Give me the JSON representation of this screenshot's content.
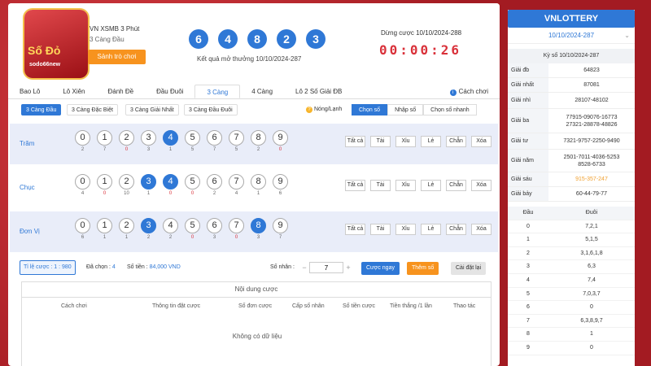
{
  "header": {
    "game_title": "VN XSMB 3 Phút",
    "game_sub": "3 Càng Đầu",
    "sponsor_btn": "Sảnh trò chơi",
    "logo_text": "Số Đỏ",
    "logo_sub": "sodo66new",
    "balls": [
      "6",
      "4",
      "8",
      "2",
      "3"
    ],
    "result_label": "Kết quả mở thưởng 10/10/2024-287",
    "deadline_label": "Dừng cược 10/10/2024-288",
    "countdown": "00:00:26"
  },
  "tabs": [
    "Bao Lô",
    "Lô Xiên",
    "Đánh Đề",
    "Đầu Đuôi",
    "3 Càng",
    "4 Càng",
    "Lô 2 Số Giải ĐB"
  ],
  "active_tab": 4,
  "howto": "Cách chơi",
  "subtabs": [
    "3 Càng Đầu",
    "3 Càng Đặc Biệt",
    "3 Càng Giải Nhất",
    "3 Càng Đầu Đuôi"
  ],
  "hot_cold": "Nóng/Lạnh",
  "modes": [
    "Chọn số",
    "Nhập số",
    "Chọn số nhanh"
  ],
  "positions": [
    {
      "label": "Trăm",
      "selected": [
        4
      ],
      "miss": [
        "2",
        "7",
        "0",
        "3",
        "1",
        "5",
        "7",
        "5",
        "2",
        "0"
      ]
    },
    {
      "label": "Chục",
      "selected": [
        3,
        4
      ],
      "miss": [
        "4",
        "0",
        "10",
        "1",
        "0",
        "0",
        "2",
        "4",
        "1",
        "6"
      ]
    },
    {
      "label": "Đơn Vị",
      "selected": [
        3,
        8
      ],
      "miss": [
        "6",
        "1",
        "1",
        "2",
        "2",
        "0",
        "3",
        "0",
        "3",
        "7"
      ]
    }
  ],
  "filters": [
    "Tất cả",
    "Tài",
    "Xỉu",
    "Lẻ",
    "Chẵn",
    "Xóa"
  ],
  "bottom": {
    "rate_label": "Tỉ lệ cược : ",
    "rate_value": "1 : 980",
    "chosen_label": "Đã chọn : ",
    "chosen_value": "4",
    "amount_label": "Số tiền : ",
    "amount_value": "84,000 VND",
    "mult_label": "Số nhân :",
    "mult_minus": "−",
    "mult_plus": "+",
    "mult_value": "7",
    "bet_now": "Cược ngay",
    "add_num": "Thêm số",
    "reset": "Cài đặt lại"
  },
  "content": {
    "title": "Nội dung cược",
    "cols": [
      "Cách chơi",
      "Thông tin đặt cược",
      "Số đơn cược",
      "Cấp số nhân",
      "Số tiền cược",
      "Tiền thắng /1 lần",
      "Thao tác"
    ],
    "empty": "Không có dữ liệu"
  },
  "right": {
    "brand": "VNLOTTERY",
    "draw_select": "10/10/2024-287",
    "ky_title": "Kỳ số 10/10/2024-287",
    "prizes": [
      {
        "name": "Giải đb",
        "value": "64823"
      },
      {
        "name": "Giải nhất",
        "value": "87081"
      },
      {
        "name": "Giải nhì",
        "value": "28107-48102"
      },
      {
        "name": "Giải ba",
        "value": "77915-09076-16773\n27321-28878-48826"
      },
      {
        "name": "Giải tư",
        "value": "7321-9757-2250-9490"
      },
      {
        "name": "Giải năm",
        "value": "2501-7011-4036-5253\n8528-6733"
      },
      {
        "name": "Giải sáu",
        "value": "915-357-247",
        "highlight": true
      },
      {
        "name": "Giải bảy",
        "value": "60-44-79-77"
      }
    ],
    "dt_head": [
      "Đầu",
      "Đuôi"
    ],
    "dt_rows": [
      [
        "0",
        "7,2,1"
      ],
      [
        "1",
        "5,1,5"
      ],
      [
        "2",
        "3,1,6,1,8"
      ],
      [
        "3",
        "6,3"
      ],
      [
        "4",
        "7,4"
      ],
      [
        "5",
        "7,0,3,7"
      ],
      [
        "6",
        "0"
      ],
      [
        "7",
        "6,3,8,9,7"
      ],
      [
        "8",
        "1"
      ],
      [
        "9",
        "0"
      ]
    ]
  }
}
